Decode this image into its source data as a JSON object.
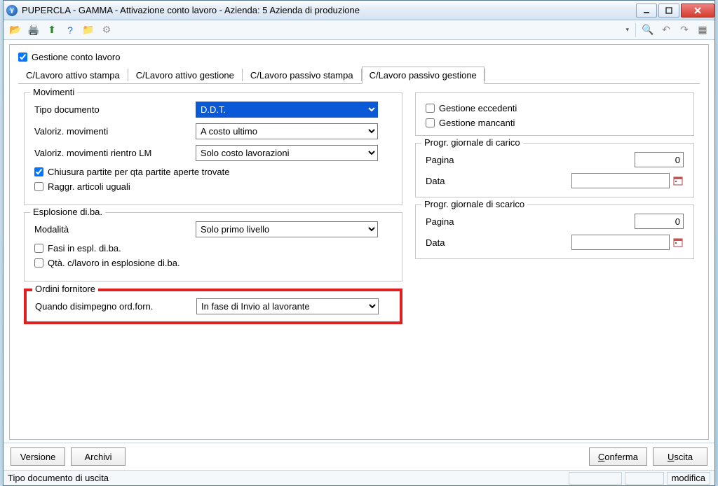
{
  "window": {
    "title": "PUPERCLA - GAMMA - Attivazione conto lavoro - Azienda:    5 Azienda di produzione"
  },
  "toolbar": {
    "icons": {
      "open": "open-icon",
      "print": "print-icon",
      "export": "export-icon",
      "help": "help-icon",
      "folder": "folder-icon",
      "gear": "gear-icon",
      "search": "search-icon",
      "undo": "undo-icon",
      "redo": "redo-icon",
      "grid": "grid-icon"
    }
  },
  "main": {
    "checkbox_label": "Gestione conto lavoro",
    "checkbox_checked": true
  },
  "tabs": [
    {
      "label": "C/Lavoro attivo stampa"
    },
    {
      "label": "C/Lavoro attivo gestione"
    },
    {
      "label": "C/Lavoro passivo stampa"
    },
    {
      "label": "C/Lavoro passivo gestione",
      "active": true
    }
  ],
  "movimenti": {
    "legend": "Movimenti",
    "tipo_documento_label": "Tipo documento",
    "tipo_documento_value": "D.D.T.",
    "valoriz_movimenti_label": "Valoriz. movimenti",
    "valoriz_movimenti_value": "A costo ultimo",
    "valoriz_rientro_label": "Valoriz. movimenti rientro LM",
    "valoriz_rientro_value": "Solo costo lavorazioni",
    "chiusura_label": "Chiusura partite per qta partite aperte trovate",
    "chiusura_checked": true,
    "raggr_label": "Raggr. articoli uguali",
    "raggr_checked": false
  },
  "esplosione": {
    "legend": "Esplosione di.ba.",
    "modalita_label": "Modalità",
    "modalita_value": "Solo primo livello",
    "fasi_label": "Fasi in espl. di.ba.",
    "fasi_checked": false,
    "qta_label": "Qtà. c/lavoro in esplosione di.ba.",
    "qta_checked": false
  },
  "ordini": {
    "legend": "Ordini fornitore",
    "quando_label": "Quando disimpegno ord.forn.",
    "quando_value": "In fase di Invio al lavorante"
  },
  "right": {
    "eccedenti_label": "Gestione eccedenti",
    "eccedenti_checked": false,
    "mancanti_label": "Gestione mancanti",
    "mancanti_checked": false,
    "carico": {
      "legend": "Progr. giornale di carico",
      "pagina_label": "Pagina",
      "pagina_value": "0",
      "data_label": "Data",
      "data_value": ""
    },
    "scarico": {
      "legend": "Progr. giornale di scarico",
      "pagina_label": "Pagina",
      "pagina_value": "0",
      "data_label": "Data",
      "data_value": ""
    }
  },
  "buttons": {
    "versione": "Versione",
    "archivi": "Archivi",
    "conferma": "Conferma",
    "uscita": "Uscita"
  },
  "status": {
    "text": "Tipo documento di uscita",
    "modifica": "modifica"
  }
}
